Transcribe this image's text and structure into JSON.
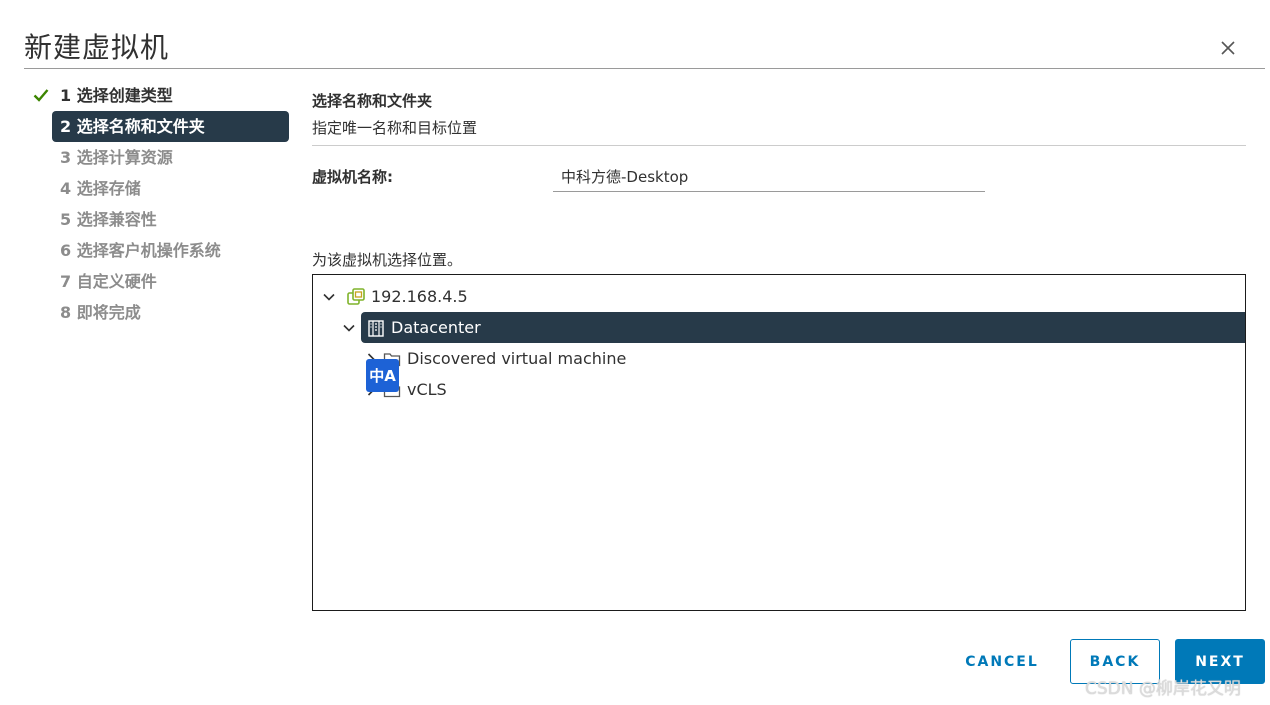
{
  "header": {
    "title": "新建虚拟机",
    "close_icon": "close-icon"
  },
  "steps": [
    {
      "label": "1 选择创建类型",
      "state": "done"
    },
    {
      "label": "2 选择名称和文件夹",
      "state": "active"
    },
    {
      "label": "3 选择计算资源",
      "state": "pending"
    },
    {
      "label": "4 选择存储",
      "state": "pending"
    },
    {
      "label": "5 选择兼容性",
      "state": "pending"
    },
    {
      "label": "6 选择客户机操作系统",
      "state": "pending"
    },
    {
      "label": "7 自定义硬件",
      "state": "pending"
    },
    {
      "label": "8 即将完成",
      "state": "pending"
    }
  ],
  "main": {
    "section_title": "选择名称和文件夹",
    "section_subtitle": "指定唯一名称和目标位置",
    "vm_name_label": "虚拟机名称:",
    "vm_name_value": "中科方德-Desktop",
    "location_label": "为该虚拟机选择位置。"
  },
  "tree": {
    "nodes": [
      {
        "label": "192.168.4.5",
        "icon": "vcenter-icon",
        "expanded": true,
        "selected": false
      },
      {
        "label": "Datacenter",
        "icon": "datacenter-icon",
        "expanded": true,
        "selected": true
      },
      {
        "label": "Discovered virtual machine",
        "icon": "folder-icon",
        "expanded": false,
        "selected": false
      },
      {
        "label": "vCLS",
        "icon": "folder-icon",
        "expanded": false,
        "selected": false
      }
    ],
    "overlay_badge": "中A"
  },
  "footer": {
    "cancel_label": "CANCEL",
    "back_label": "BACK",
    "next_label": "NEXT"
  },
  "watermark": "CSDN @柳岸花又明",
  "colors": {
    "accent": "#0079b8",
    "selected_bg": "#273a49",
    "check": "#3c8500"
  }
}
